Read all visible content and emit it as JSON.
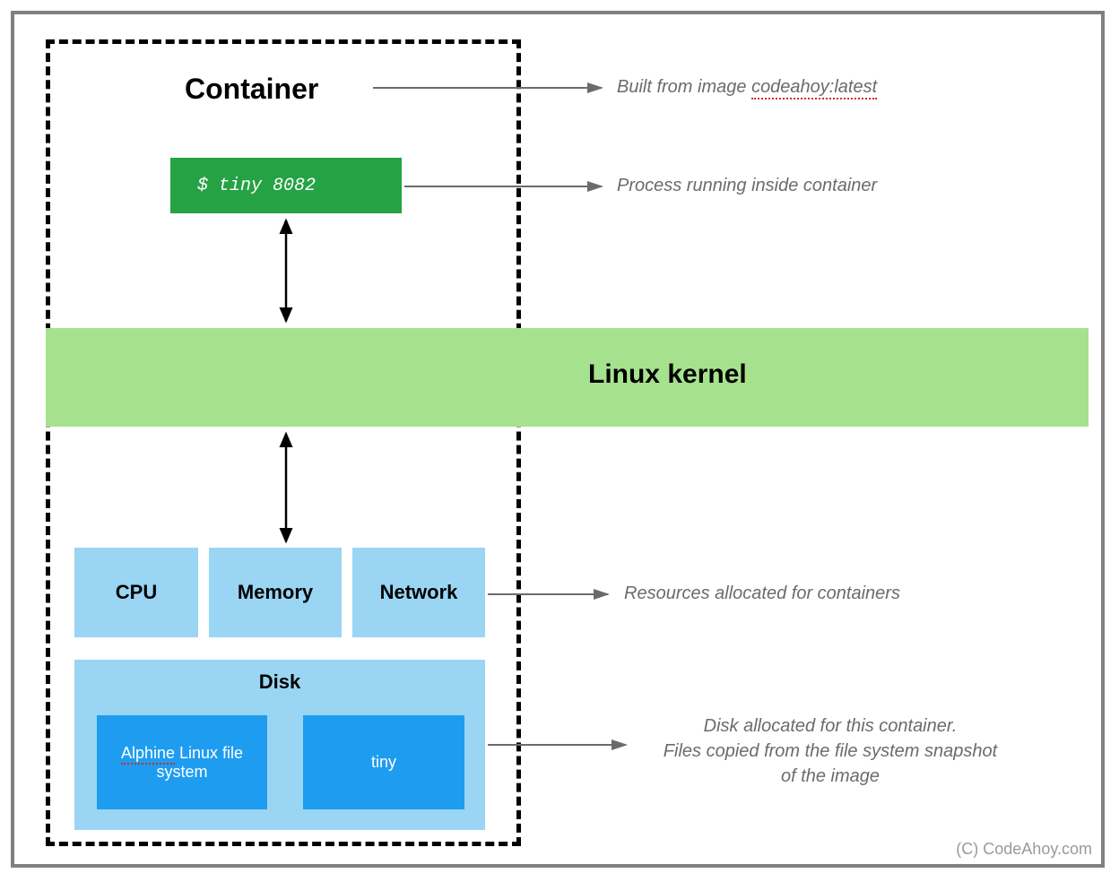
{
  "title": "Container",
  "process_command": "$ tiny 8082",
  "kernel_label": "Linux kernel",
  "resources": {
    "cpu": "CPU",
    "memory": "Memory",
    "network": "Network"
  },
  "disk": {
    "label": "Disk",
    "fs": "Alphine Linux file system",
    "app": "tiny"
  },
  "annotations": {
    "container": {
      "prefix": "Built from image ",
      "image_name": "codeahoy:latest"
    },
    "process": "Process running inside container",
    "resources": "Resources allocated for containers",
    "disk_line1": "Disk allocated for this container.",
    "disk_line2": "Files copied from the file system snapshot",
    "disk_line3": "of the image"
  },
  "attribution": "(C) CodeAhoy.com"
}
